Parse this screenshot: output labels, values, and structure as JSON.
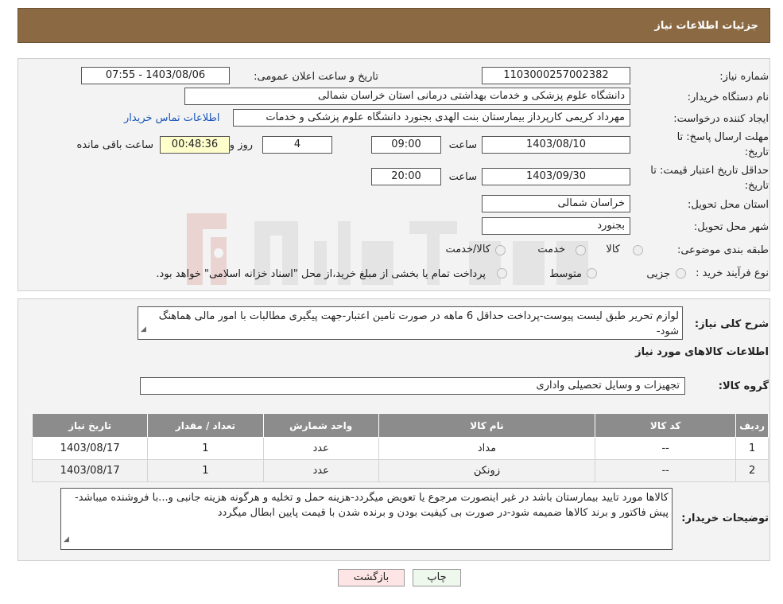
{
  "header": {
    "title": "جزئیات اطلاعات نیاز"
  },
  "form": {
    "need_number_label": "شماره نیاز:",
    "need_number": "1103000257002382",
    "announce_label": "تاریخ و ساعت اعلان عمومی:",
    "announce_value": "1403/08/06 - 07:55",
    "buyer_org_label": "نام دستگاه خریدار:",
    "buyer_org": "دانشگاه علوم پزشکی و خدمات بهداشتی درمانی استان خراسان شمالی",
    "requester_label": "ایجاد کننده درخواست:",
    "requester": "مهرداد کریمی کارپرداز بیمارستان بنت الهدی بجنورد دانشگاه علوم پزشکی و خدمات",
    "contact_link": "اطلاعات تماس خریدار",
    "deadline_label_1": "مهلت ارسال پاسخ: تا",
    "deadline_label_2": "تاریخ:",
    "deadline_date": "1403/08/10",
    "time_label": "ساعت",
    "deadline_time": "09:00",
    "days_value": "4",
    "days_label": "روز و",
    "remaining_time": "00:48:36",
    "remaining_label": "ساعت باقی مانده",
    "validity_label_1": "حداقل تاریخ اعتبار قیمت: تا",
    "validity_label_2": "تاریخ:",
    "validity_date": "1403/09/30",
    "validity_time_label": "ساعت",
    "validity_time": "20:00",
    "province_label": "استان محل تحویل:",
    "province": "خراسان شمالی",
    "city_label": "شهر محل تحویل:",
    "city": "بجنورد",
    "category_label": "طبقه بندی موضوعی:",
    "category_options": [
      "کالا",
      "خدمت",
      "کالا/خدمت"
    ],
    "process_label": "نوع فرآیند خرید :",
    "process_options": [
      "جزیی",
      "متوسط"
    ],
    "process_note": "پرداخت تمام یا بخشی از مبلغ خرید،از محل \"اسناد خزانه اسلامی\" خواهد بود."
  },
  "details": {
    "summary_label": "شرح کلی نیاز:",
    "summary_text": "لوازم تحریر طبق لیست پیوست-پرداخت حداقل 6 ماهه در صورت تامین اعتبار-جهت پیگیری مطالبات با امور مالی هماهنگ شود-",
    "goods_info_title": "اطلاعات کالاهای مورد نیاز",
    "goods_group_label": "گروه کالا:",
    "goods_group": "تجهیزات و وسایل تحصیلی واداری",
    "table": {
      "headers": [
        "ردیف",
        "کد کالا",
        "نام کالا",
        "واحد شمارش",
        "تعداد / مقدار",
        "تاریخ نیاز"
      ],
      "rows": [
        [
          "1",
          "--",
          "مداد",
          "عدد",
          "1",
          "1403/08/17"
        ],
        [
          "2",
          "--",
          "زونکن",
          "عدد",
          "1",
          "1403/08/17"
        ]
      ]
    },
    "buyer_notes_label": "توضیحات خریدار:",
    "buyer_notes": "کالاها مورد تایید بیمارستان باشد در غیر اینصورت مرجوع یا تعویض میگردد-هزینه حمل و تخلیه و هرگونه هزینه جانبی و...با فروشنده میباشد-پیش فاکتور و برند کالاها ضمیمه شود-در صورت بی کیفیت بودن و برنده شدن با قیمت پایین ابطال میگردد"
  },
  "buttons": {
    "print": "چاپ",
    "back": "بازگشت"
  },
  "colors": {
    "header": "#8b6a43",
    "table_header": "#8c8c8c",
    "back_button": "#fde5e5",
    "print_button": "#eef8ec",
    "link": "#1a56b8"
  }
}
